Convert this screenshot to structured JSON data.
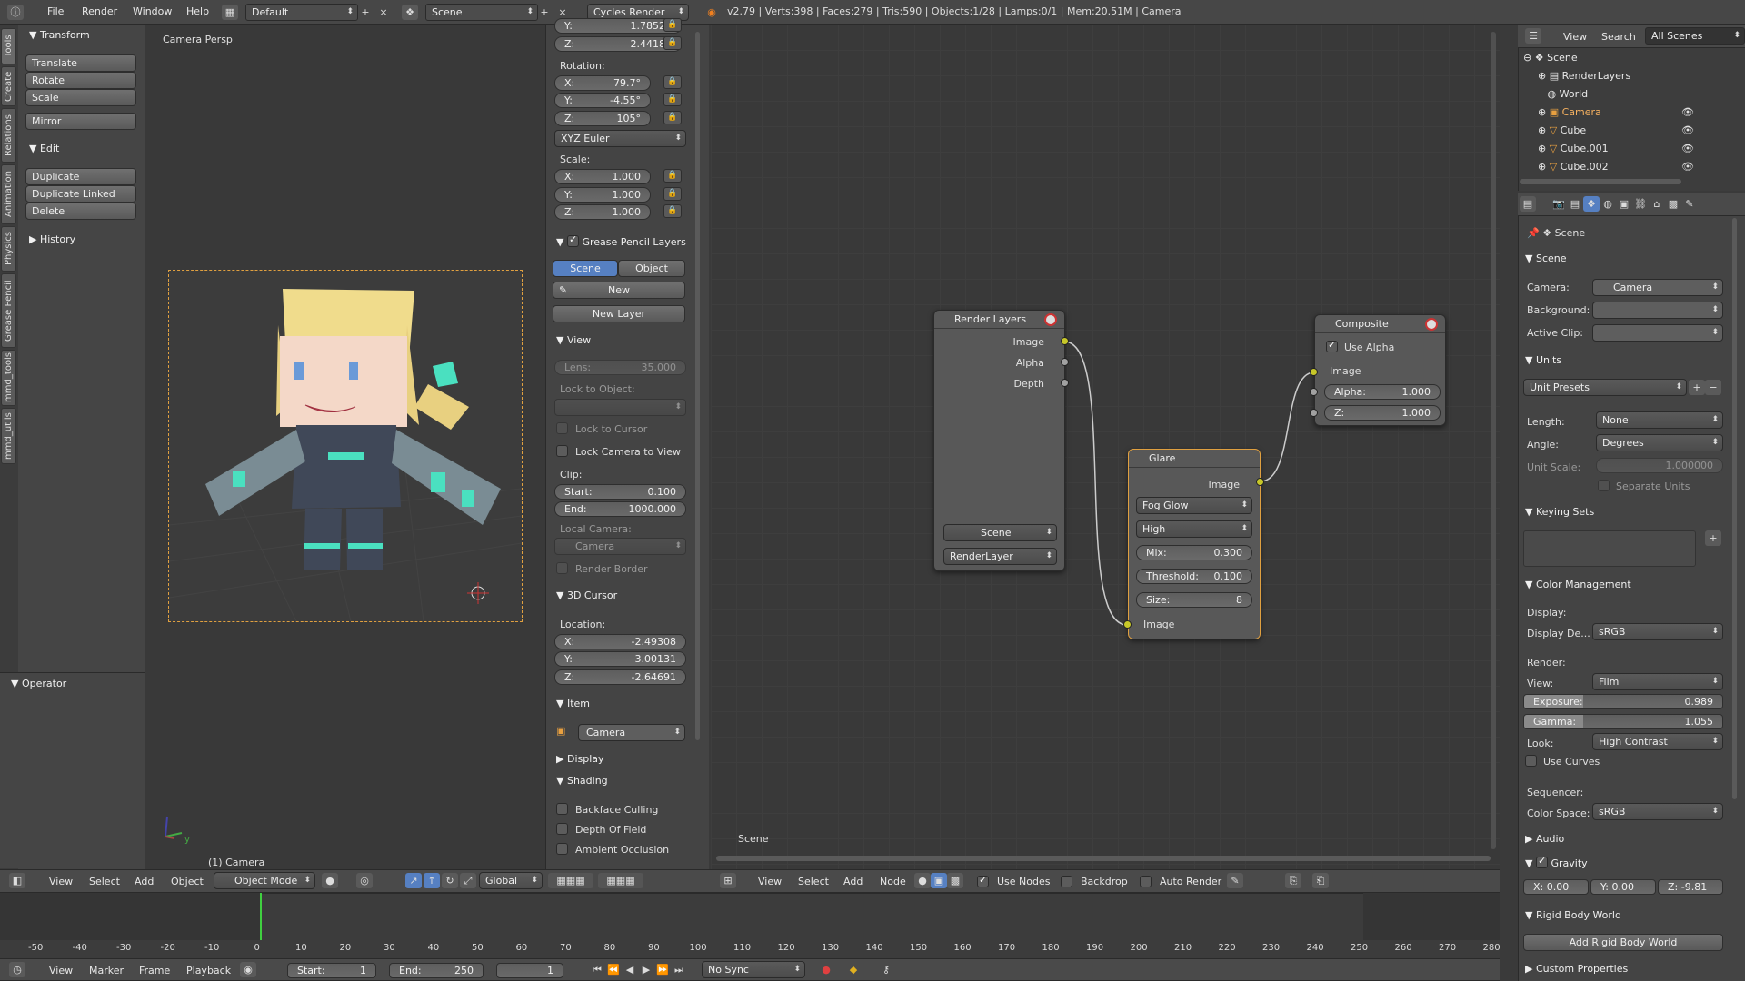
{
  "topbar": {
    "menus": [
      "File",
      "Render",
      "Window",
      "Help"
    ],
    "layout": "Default",
    "scene": "Scene",
    "engine": "Cycles Render",
    "stats": "v2.79 | Verts:398 | Faces:279 | Tris:590 | Objects:1/28 | Lamps:0/1 | Mem:20.51M | Camera"
  },
  "toolshelf": {
    "tabs": [
      "Tools",
      "Create",
      "Relations",
      "Animation",
      "Physics",
      "Grease Pencil",
      "mmd_tools",
      "mmd_utils"
    ],
    "transform_title": "Transform",
    "transform_buttons": [
      "Translate",
      "Rotate",
      "Scale"
    ],
    "mirror": "Mirror",
    "edit_title": "Edit",
    "edit_buttons": [
      "Duplicate",
      "Duplicate Linked",
      "Delete"
    ],
    "history_title": "History",
    "operator_title": "Operator"
  },
  "viewport": {
    "label": "Camera Persp",
    "object_label": "(1) Camera",
    "axis_y": "y"
  },
  "npanel": {
    "loc_y": "1.78520",
    "loc_z_label": "Z:",
    "loc_z": "2.44183",
    "rotation_title": "Rotation:",
    "rot_x": "79.7°",
    "rot_y": "-4.55°",
    "rot_z": "105°",
    "rot_mode": "XYZ Euler",
    "scale_title": "Scale:",
    "scale_x": "1.000",
    "scale_y": "1.000",
    "scale_z": "1.000",
    "gp_title": "Grease Pencil Layers",
    "gp_scene": "Scene",
    "gp_object": "Object",
    "gp_new": "New",
    "gp_new_layer": "New Layer",
    "view_title": "View",
    "lens_label": "Lens:",
    "lens_val": "35.000",
    "lock_obj": "Lock to Object:",
    "lock_cursor": "Lock to Cursor",
    "lock_cam": "Lock Camera to View",
    "clip": "Clip:",
    "clip_start_label": "Start:",
    "clip_start": "0.100",
    "clip_end_label": "End:",
    "clip_end": "1000.000",
    "local_cam": "Local Camera:",
    "local_cam_val": "Camera",
    "render_border": "Render Border",
    "cursor_title": "3D Cursor",
    "location": "Location:",
    "cur_x": "-2.49308",
    "cur_y": "3.00131",
    "cur_z": "-2.64691",
    "item_title": "Item",
    "item_name": "Camera",
    "display_title": "Display",
    "shading_title": "Shading",
    "backface": "Backface Culling",
    "dof": "Depth Of Field",
    "ao": "Ambient Occlusion",
    "x": "X:",
    "y": "Y:",
    "z": "Z:"
  },
  "nodes": {
    "render_layers": {
      "title": "Render Layers",
      "outputs": [
        "Image",
        "Alpha",
        "Depth"
      ],
      "scene": "Scene",
      "layer": "RenderLayer"
    },
    "glare": {
      "title": "Glare",
      "out": "Image",
      "type": "Fog Glow",
      "quality": "High",
      "mix_label": "Mix:",
      "mix": "0.300",
      "threshold_label": "Threshold:",
      "threshold": "0.100",
      "size_label": "Size:",
      "size": "8",
      "in": "Image"
    },
    "composite": {
      "title": "Composite",
      "use_alpha": "Use Alpha",
      "image": "Image",
      "alpha_label": "Alpha:",
      "alpha": "1.000",
      "z_label": "Z:",
      "z": "1.000"
    },
    "footer_label": "Scene"
  },
  "view3d_header": {
    "menus": [
      "View",
      "Select",
      "Add",
      "Object"
    ],
    "mode": "Object Mode",
    "orientation": "Global"
  },
  "node_header": {
    "menus": [
      "View",
      "Select",
      "Add",
      "Node"
    ],
    "use_nodes": "Use Nodes",
    "backdrop": "Backdrop",
    "auto_render": "Auto Render"
  },
  "outliner": {
    "menus": [
      "View",
      "Search"
    ],
    "filter": "All Scenes",
    "items": [
      "Scene",
      "RenderLayers",
      "World",
      "Camera",
      "Cube",
      "Cube.001",
      "Cube.002"
    ]
  },
  "properties": {
    "context": "Scene",
    "scene_title": "Scene",
    "camera_label": "Camera:",
    "camera_val": "Camera",
    "background_label": "Background:",
    "active_clip_label": "Active Clip:",
    "units_title": "Units",
    "unit_presets": "Unit Presets",
    "length_label": "Length:",
    "length": "None",
    "angle_label": "Angle:",
    "angle": "Degrees",
    "unit_scale_label": "Unit Scale:",
    "unit_scale": "1.000000",
    "separate_units": "Separate Units",
    "keying_title": "Keying Sets",
    "cm_title": "Color Management",
    "display_label": "Display:",
    "display_device_label": "Display De...",
    "display_device": "sRGB",
    "render_label": "Render:",
    "view_label": "View:",
    "view_val": "Film",
    "exposure_label": "Exposure:",
    "exposure": "0.989",
    "exposure_frac": 0.3,
    "gamma_label": "Gamma:",
    "gamma": "1.055",
    "gamma_frac": 0.3,
    "look_label": "Look:",
    "look": "High Contrast",
    "use_curves": "Use Curves",
    "sequencer_label": "Sequencer:",
    "color_space_label": "Color Space:",
    "color_space": "sRGB",
    "audio_title": "Audio",
    "gravity_title": "Gravity",
    "gx": "X:  0.00",
    "gy": "Y:  0.00",
    "gz": "Z:  -9.81",
    "rbw_title": "Rigid Body World",
    "add_rbw": "Add Rigid Body World",
    "custom_title": "Custom Properties"
  },
  "timeline": {
    "ticks": [
      "-50",
      "-40",
      "-30",
      "-20",
      "-10",
      "0",
      "10",
      "20",
      "30",
      "40",
      "50",
      "60",
      "70",
      "80",
      "90",
      "100",
      "110",
      "120",
      "130",
      "140",
      "150",
      "160",
      "170",
      "180",
      "190",
      "200",
      "210",
      "220",
      "230",
      "240",
      "250",
      "260",
      "270",
      "280"
    ],
    "menus": [
      "View",
      "Marker",
      "Frame",
      "Playback"
    ],
    "start_label": "Start:",
    "start": "1",
    "end_label": "End:",
    "end": "250",
    "current": "1",
    "sync": "No Sync"
  }
}
